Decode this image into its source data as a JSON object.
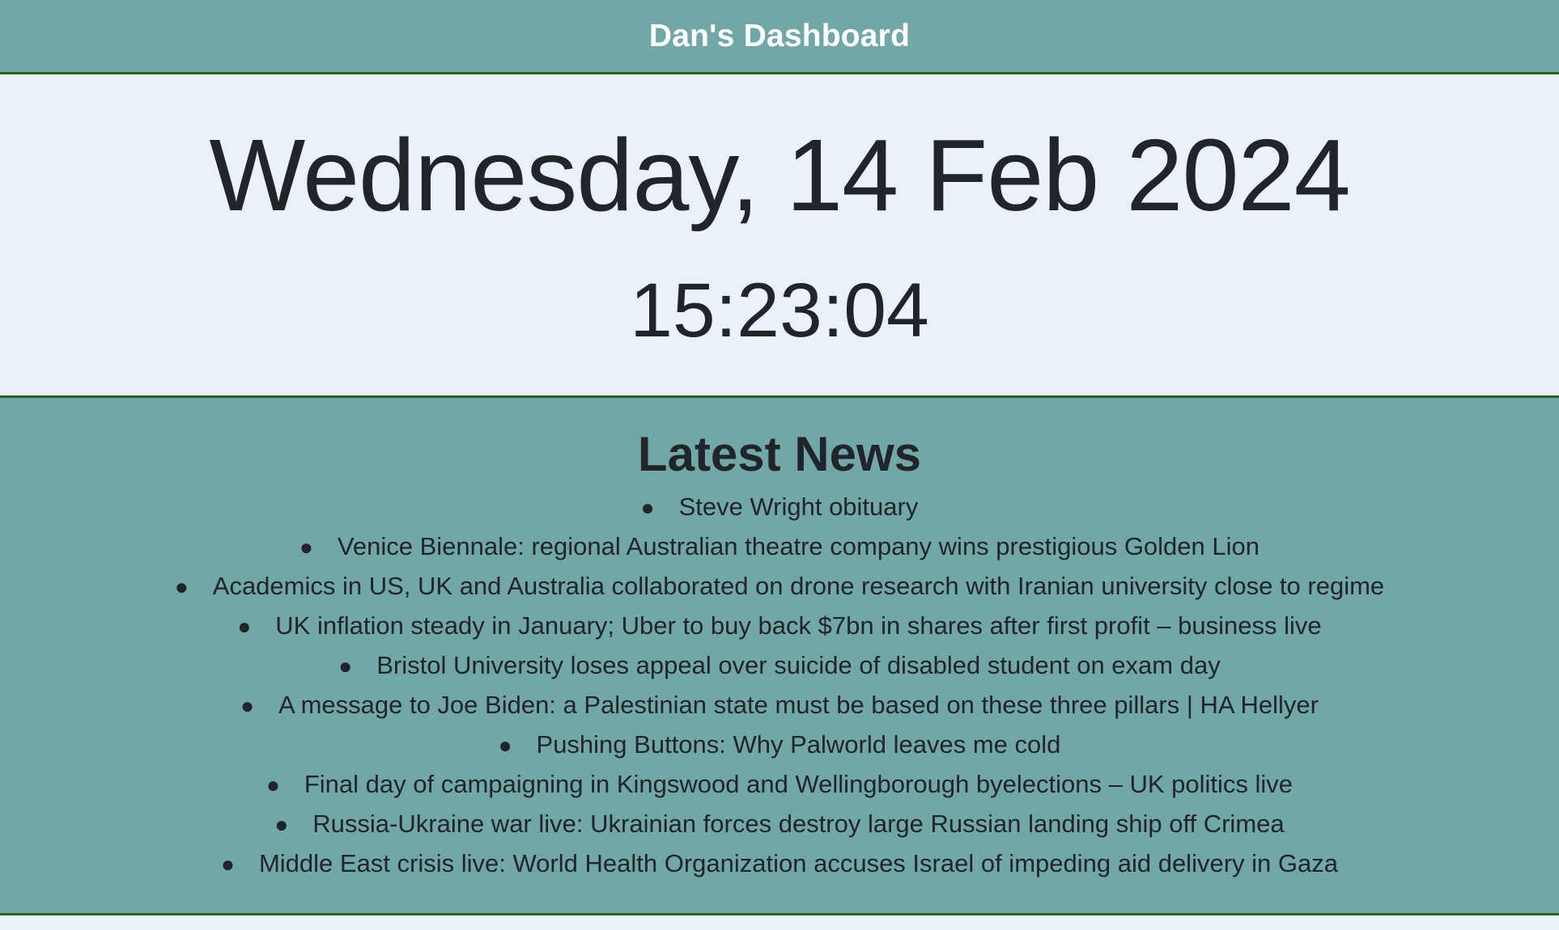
{
  "header": {
    "title": "Dan's Dashboard"
  },
  "clock": {
    "date": "Wednesday, 14 Feb 2024",
    "time": "15:23:04"
  },
  "news": {
    "title": "Latest News",
    "items": [
      "Steve Wright obituary",
      "Venice Biennale: regional Australian theatre company wins prestigious Golden Lion",
      "Academics in US, UK and Australia collaborated on drone research with Iranian university close to regime",
      "UK inflation steady in January; Uber to buy back $7bn in shares after first profit – business live",
      "Bristol University loses appeal over suicide of disabled student on exam day",
      "A message to Joe Biden: a Palestinian state must be based on these three pillars | HA Hellyer",
      "Pushing Buttons: Why Palworld leaves me cold",
      "Final day of campaigning in Kingswood and Wellingborough byelections – UK politics live",
      "Russia-Ukraine war live: Ukrainian forces destroy large Russian landing ship off Crimea",
      "Middle East crisis live: World Health Organization accuses Israel of impeding aid delivery in Gaza"
    ]
  },
  "colors": {
    "panel_teal": "#72a7a8",
    "page_background": "#ebf1f9",
    "divider_green": "#2d5f1f",
    "header_text": "#ffffff",
    "body_text": "#212529"
  }
}
